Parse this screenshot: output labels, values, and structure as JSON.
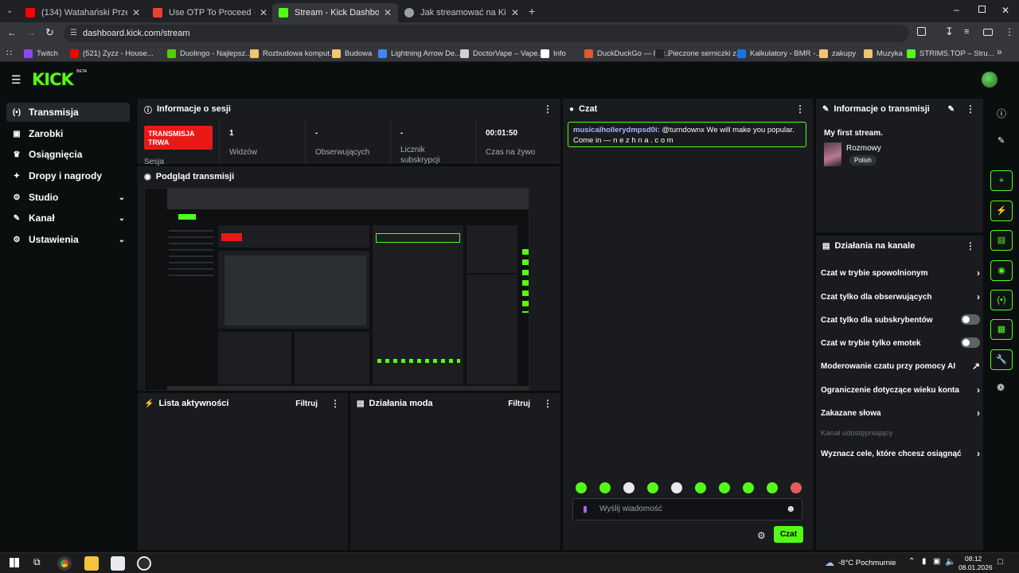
{
  "browser": {
    "tabs": [
      {
        "title": "(134) Watahański Przegląd Inte",
        "favicon_color": "#ff0000",
        "active": false
      },
      {
        "title": "Use OTP To Proceed - turndow",
        "favicon_color": "#ea4335",
        "active": false
      },
      {
        "title": "Stream - Kick Dashboard",
        "favicon_color": "#53fc18",
        "active": true
      },
      {
        "title": "Jak streamować na Kick",
        "favicon_color": "#9aa0a6",
        "active": false
      }
    ],
    "url": "dashboard.kick.com/stream",
    "bookmarks": [
      {
        "label": "Twitch",
        "color": "#9146ff"
      },
      {
        "label": "(521) Zyzz - House...",
        "color": "#ff0000"
      },
      {
        "label": "Duolingo - Najlepsz...",
        "color": "#58cc02"
      },
      {
        "label": "Rozbudowa komput...",
        "color": "#f0c674"
      },
      {
        "label": "Budowa",
        "color": "#f0c674"
      },
      {
        "label": "Lightning Arrow De...",
        "color": "#4285f4"
      },
      {
        "label": "DoctorVape – Vape...",
        "color": "#d0d0d0"
      },
      {
        "label": "Info",
        "color": "#ffffff"
      },
      {
        "label": "DuckDuckGo — Pry...",
        "color": "#de5833"
      },
      {
        "label": "Pieczone serniczki z...",
        "color": "#222222"
      },
      {
        "label": "Kalkulatory - BMR -...",
        "color": "#1a73e8"
      },
      {
        "label": "zakupy",
        "color": "#f0c674"
      },
      {
        "label": "Muzyka",
        "color": "#f0c674"
      },
      {
        "label": "STRIMS.TOP – Stru...",
        "color": "#53fc18"
      }
    ]
  },
  "app": {
    "logo": "KICK",
    "logo_tag": "BETA",
    "brand_color": "#53fc18",
    "nav": [
      {
        "label": "Transmisja",
        "icon": "broadcast-icon",
        "expandable": false,
        "active": true
      },
      {
        "label": "Zarobki",
        "icon": "earnings-icon",
        "expandable": false,
        "active": false
      },
      {
        "label": "Osiągnięcia",
        "icon": "trophy-icon",
        "expandable": false,
        "active": false
      },
      {
        "label": "Dropy i nagrody",
        "icon": "gift-icon",
        "expandable": false,
        "active": false
      },
      {
        "label": "Studio",
        "icon": "studio-icon",
        "expandable": true,
        "active": false
      },
      {
        "label": "Kanał",
        "icon": "channel-icon",
        "expandable": true,
        "active": false
      },
      {
        "label": "Ustawienia",
        "icon": "settings-icon",
        "expandable": true,
        "active": false
      }
    ],
    "session": {
      "title": "Informacje o sesji",
      "live_badge": "TRANSMISJA TRWA",
      "session_label": "Sesja",
      "stats": [
        {
          "value": "1",
          "label": "Widzów"
        },
        {
          "value": "-",
          "label": "Obserwujących"
        },
        {
          "value": "-",
          "label": "Licznik subskrypcji"
        },
        {
          "value": "00:01:50",
          "label": "Czas na żywo"
        }
      ]
    },
    "preview": {
      "title": "Podgląd transmisji"
    },
    "activity": {
      "title": "Lista aktywności",
      "filter": "Filtruj"
    },
    "modactions": {
      "title": "Działania moda",
      "filter": "Filtruj"
    },
    "chat": {
      "title": "Czat",
      "messages": [
        {
          "user": "musicalhollerydmpsd0i:",
          "text": "@turndownx We will make you popular. Come in — n e z h n a . c o m"
        }
      ],
      "placeholder": "Wyślij wiadomość",
      "send": "Czat"
    },
    "stream_info": {
      "title": "Informacje o transmisji",
      "stream_title": "My first stream.",
      "category": "Rozmowy",
      "language": "Polish"
    },
    "channel_actions": {
      "title": "Działania na kanale",
      "items": [
        {
          "label": "Czat w trybie spowolnionym",
          "control": "chevron"
        },
        {
          "label": "Czat tylko dla obserwujących",
          "control": "chevron"
        },
        {
          "label": "Czat tylko dla subskrybentów",
          "control": "toggle"
        },
        {
          "label": "Czat w trybie tylko emotek",
          "control": "toggle"
        },
        {
          "label": "Moderowanie czatu przy pomocy AI",
          "control": "external"
        },
        {
          "label": "Ograniczenie dotyczące wieku konta",
          "control": "chevron"
        },
        {
          "label": "Zakazane słowa",
          "control": "chevron"
        }
      ],
      "section_label": "Kanał udostępniający",
      "goals": "Wyznacz cele, które chcesz osiągnąć"
    }
  },
  "taskbar": {
    "weather": "-8°C Pochmurnie",
    "time": "08:12",
    "date": "08.01.2026"
  }
}
